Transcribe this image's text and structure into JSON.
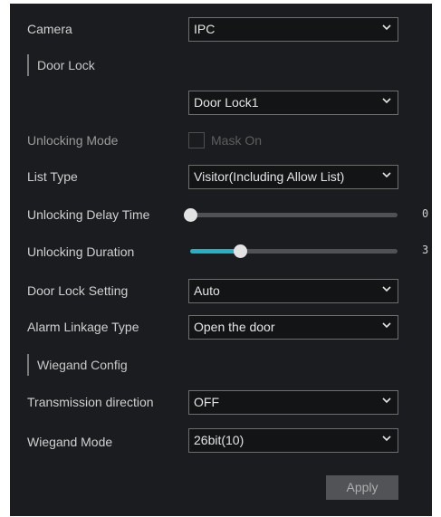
{
  "camera": {
    "label": "Camera",
    "value": "IPC"
  },
  "door_lock_section": {
    "title": "Door Lock",
    "value": "Door Lock1"
  },
  "unlocking_mode": {
    "label": "Unlocking Mode",
    "checkbox_label": "Mask On",
    "checked": false
  },
  "list_type": {
    "label": "List Type",
    "value": "Visitor(Including Allow List)"
  },
  "unlocking_delay": {
    "label": "Unlocking Delay Time",
    "value": "0",
    "fraction": 0.0
  },
  "unlocking_duration": {
    "label": "Unlocking Duration",
    "value": "3",
    "fraction": 0.24
  },
  "door_lock_setting": {
    "label": "Door Lock Setting",
    "value": "Auto"
  },
  "alarm_linkage_type": {
    "label": "Alarm Linkage Type",
    "value": "Open the door"
  },
  "wiegand_section": {
    "title": "Wiegand Config"
  },
  "transmission_direction": {
    "label": "Transmission direction",
    "value": "OFF"
  },
  "wiegand_mode": {
    "label": "Wiegand Mode",
    "value": "26bit(10)"
  },
  "apply_button": {
    "label": "Apply"
  },
  "colors": {
    "accent": "#20b2c6",
    "background": "#1b1c1f"
  }
}
